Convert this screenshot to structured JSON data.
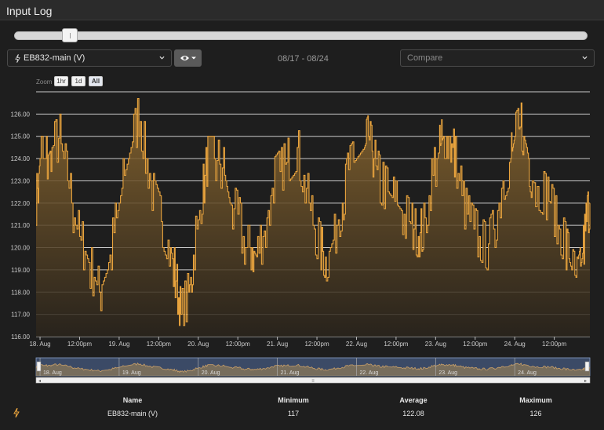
{
  "header": {
    "title": "Input Log"
  },
  "range_slider": {
    "position": 0.09
  },
  "device_select": {
    "value": "EB832-main (V)",
    "icon": "bolt-icon"
  },
  "visibility_button": {
    "icon": "eye-icon"
  },
  "date_range": "08/17 - 08/24",
  "compare_select": {
    "placeholder": "Compare"
  },
  "zoom": {
    "label": "Zoom",
    "buttons": [
      "1hr",
      "1d",
      "All"
    ],
    "active": "All"
  },
  "colors": {
    "accent": "#e8a33d",
    "background": "#1e1e1e",
    "grid": "#e8e8e8",
    "navigator": "#3b4a66"
  },
  "chart_data": {
    "type": "area",
    "title": "",
    "xlabel": "",
    "ylabel": "",
    "ylim": [
      116,
      127
    ],
    "yticks": [
      "116.00",
      "117.00",
      "118.00",
      "119.00",
      "120.00",
      "121.00",
      "122.00",
      "123.00",
      "124.00",
      "125.00",
      "126.00"
    ],
    "xticks": [
      "18. Aug",
      "12:00pm",
      "19. Aug",
      "12:00pm",
      "20. Aug",
      "12:00pm",
      "21. Aug",
      "12:00pm",
      "22. Aug",
      "12:00pm",
      "23. Aug",
      "12:00pm",
      "24. Aug",
      "12:00pm"
    ],
    "xlim_days": [
      17.95,
      24.95
    ],
    "grid": true,
    "series": [
      {
        "name": "EB832-main (V)",
        "points": [
          [
            17.95,
            122
          ],
          [
            18.0,
            124
          ],
          [
            18.08,
            124
          ],
          [
            18.15,
            124.5
          ],
          [
            18.25,
            125
          ],
          [
            18.35,
            123
          ],
          [
            18.45,
            121
          ],
          [
            18.55,
            120
          ],
          [
            18.65,
            119
          ],
          [
            18.75,
            118
          ],
          [
            18.85,
            119
          ],
          [
            18.95,
            121
          ],
          [
            19.05,
            123
          ],
          [
            19.15,
            124.5
          ],
          [
            19.25,
            126
          ],
          [
            19.35,
            124
          ],
          [
            19.45,
            122
          ],
          [
            19.55,
            121
          ],
          [
            19.65,
            120
          ],
          [
            19.72,
            118.5
          ],
          [
            19.78,
            117
          ],
          [
            19.88,
            118
          ],
          [
            19.95,
            120
          ],
          [
            20.05,
            122.5
          ],
          [
            20.12,
            124
          ],
          [
            20.22,
            124
          ],
          [
            20.32,
            123.5
          ],
          [
            20.4,
            122
          ],
          [
            20.5,
            121.5
          ],
          [
            20.6,
            120
          ],
          [
            20.68,
            120
          ],
          [
            20.75,
            119.5
          ],
          [
            20.85,
            121
          ],
          [
            20.95,
            123
          ],
          [
            21.05,
            123.5
          ],
          [
            21.15,
            124
          ],
          [
            21.25,
            124.5
          ],
          [
            21.35,
            123
          ],
          [
            21.45,
            121
          ],
          [
            21.55,
            120
          ],
          [
            21.62,
            119.5
          ],
          [
            21.72,
            120.5
          ],
          [
            21.82,
            122
          ],
          [
            21.9,
            123.5
          ],
          [
            22.0,
            124
          ],
          [
            22.1,
            124.5
          ],
          [
            22.15,
            125
          ],
          [
            22.22,
            124
          ],
          [
            22.3,
            123
          ],
          [
            22.4,
            122.5
          ],
          [
            22.5,
            122
          ],
          [
            22.6,
            121.5
          ],
          [
            22.7,
            121
          ],
          [
            22.78,
            120.5
          ],
          [
            22.85,
            121
          ],
          [
            22.95,
            123
          ],
          [
            23.05,
            124.5
          ],
          [
            23.1,
            125
          ],
          [
            23.18,
            125
          ],
          [
            23.25,
            124
          ],
          [
            23.35,
            122
          ],
          [
            23.45,
            121
          ],
          [
            23.55,
            120.5
          ],
          [
            23.65,
            120
          ],
          [
            23.75,
            121
          ],
          [
            23.85,
            123
          ],
          [
            23.95,
            124
          ],
          [
            24.0,
            125
          ],
          [
            24.08,
            125.5
          ],
          [
            24.15,
            124.5
          ],
          [
            24.22,
            123
          ],
          [
            24.35,
            122.5
          ],
          [
            24.45,
            122
          ],
          [
            24.55,
            121
          ],
          [
            24.65,
            120
          ],
          [
            24.72,
            119
          ],
          [
            24.8,
            118.5
          ],
          [
            24.85,
            119.5
          ],
          [
            24.9,
            121
          ],
          [
            24.95,
            122
          ]
        ]
      }
    ]
  },
  "navigator": {
    "labels": [
      "18. Aug",
      "19. Aug",
      "20. Aug",
      "21. Aug",
      "22. Aug",
      "23. Aug",
      "24. Aug"
    ],
    "scrollbar_grip": "≡"
  },
  "stats": {
    "headers": {
      "name": "Name",
      "minimum": "Minimum",
      "average": "Average",
      "maximum": "Maximum"
    },
    "rows": [
      {
        "icon": "bolt-icon",
        "name": "EB832-main (V)",
        "minimum": "117",
        "average": "122.08",
        "maximum": "126"
      }
    ]
  }
}
